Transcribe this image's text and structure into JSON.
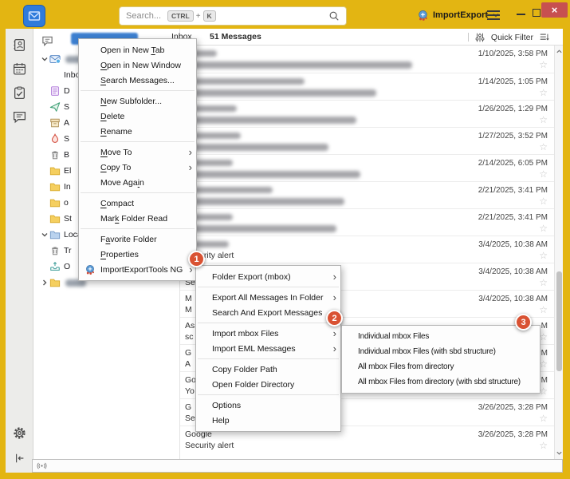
{
  "titlebar": {
    "search_placeholder": "Search...",
    "ctrl_key": "CTRL",
    "plus": "+",
    "k_key": "K",
    "addon_button_label": "ImportExport",
    "close_glyph": "×"
  },
  "header": {
    "folder_tab_label": "Inbox",
    "message_count": "51 Messages",
    "quick_filter_label": "Quick Filter"
  },
  "badges": {
    "one": "1",
    "two": "2",
    "three": "3"
  },
  "colors": {
    "titlebar_yellow": "#e3b512",
    "close_button_red": "#c75050",
    "selection_blue": "#1373d9",
    "badge_orange": "#d95233",
    "menu_highlight_grey": "#d2d2d2"
  },
  "icon_names": [
    "mail-space-icon",
    "search-icon",
    "hamburger-icon",
    "address-book-icon",
    "calendar-icon",
    "tasks-icon",
    "chat-icon",
    "gear-icon",
    "collapse-icon",
    "new-message-bubble-icon",
    "quick-filter-icon",
    "display-options-icon",
    "star-icon",
    "radio-tower-icon",
    "importexporttools-icon",
    "chevron-icons",
    "folder-icons"
  ],
  "folders": [
    {
      "icon": "account",
      "chevron": "chevron-down",
      "blur_w": 72,
      "bold": true,
      "indent": 0
    },
    {
      "icon": "inbox",
      "label": "Inbox",
      "selected": true,
      "indent": 1
    },
    {
      "icon": "drafts",
      "label": "D",
      "indent": 1
    },
    {
      "icon": "sent",
      "label": "S",
      "indent": 1
    },
    {
      "icon": "archive",
      "label": "A",
      "indent": 1
    },
    {
      "icon": "spam",
      "label": "S",
      "indent": 1
    },
    {
      "icon": "trash",
      "label": "B",
      "indent": 1
    },
    {
      "icon": "folder",
      "label": "El",
      "indent": 1
    },
    {
      "icon": "folder",
      "label": "In",
      "indent": 1
    },
    {
      "icon": "folder",
      "label": "o",
      "indent": 1
    },
    {
      "icon": "folder",
      "label": "St",
      "indent": 1
    },
    {
      "icon": "folder-blue",
      "label": "Local Folders",
      "chevron": "chevron-down",
      "bold": true,
      "indent": 0
    },
    {
      "icon": "trash",
      "label": "Tr",
      "indent": 1
    },
    {
      "icon": "outbox",
      "label": "O",
      "indent": 1
    },
    {
      "icon": "folder",
      "chevron": "chevron-right",
      "blur_w": 26,
      "dashed": true,
      "indent": 1
    }
  ],
  "menu1": {
    "items": [
      {
        "label": "Open in New Tab",
        "u": 12
      },
      {
        "label": "Open in New Window",
        "u": 0
      },
      {
        "label": "Search Messages...",
        "u": 0,
        "sep_after": true
      },
      {
        "label": "New Subfolder...",
        "u": 0
      },
      {
        "label": "Delete",
        "u": 0
      },
      {
        "label": "Rename",
        "u": 0,
        "sep_after": true
      },
      {
        "label": "Move To",
        "u": 0,
        "arrow": true
      },
      {
        "label": "Copy To",
        "u": 0,
        "arrow": true
      },
      {
        "label": "Move Again",
        "u": 8,
        "sep_after": true
      },
      {
        "label": "Compact",
        "u": 0
      },
      {
        "label": "Mark Folder Read",
        "u": 3,
        "sep_after": true
      },
      {
        "label": "Favorite Folder",
        "u": 1
      },
      {
        "label": "Properties",
        "u": 0
      },
      {
        "label": "ImportExportTools NG",
        "icon": "iet",
        "arrow": true,
        "highlight": true
      }
    ]
  },
  "menu2": {
    "items": [
      {
        "label": "Folder Export (mbox)",
        "arrow": true,
        "sep_after": true
      },
      {
        "label": "Export All Messages In Folder",
        "arrow": true
      },
      {
        "label": "Search And Export Messages",
        "sep_after": true
      },
      {
        "label": "Import mbox Files",
        "arrow": true,
        "highlight": true
      },
      {
        "label": "Import EML Messages",
        "arrow": true,
        "sep_after": true
      },
      {
        "label": "Copy Folder Path"
      },
      {
        "label": "Open Folder Directory",
        "sep_after": true
      },
      {
        "label": "Options"
      },
      {
        "label": "Help"
      }
    ]
  },
  "menu3": {
    "items": [
      {
        "label": "Individual mbox Files",
        "highlight": true
      },
      {
        "label": "Individual mbox Files (with sbd structure)"
      },
      {
        "label": "All mbox Files from directory"
      },
      {
        "label": "All mbox Files from directory (with sbd structure)"
      }
    ]
  },
  "messages": [
    {
      "sender_blur_w": 40,
      "subject_blur_w": 285,
      "unread": true,
      "date": "1/10/2025, 3:58 PM"
    },
    {
      "sender_blur_w": 150,
      "subject_blur_w": 240,
      "date": "1/14/2025, 1:05 PM"
    },
    {
      "sender_blur_w": 65,
      "subject_blur_w": 215,
      "date": "1/26/2025, 1:29 PM"
    },
    {
      "sender_blur_w": 70,
      "subject_blur_w": 180,
      "unread": true,
      "date": "1/27/2025, 3:52 PM"
    },
    {
      "sender_blur_w": 60,
      "subject_blur_w": 220,
      "unread": true,
      "date": "2/14/2025, 6:05 PM"
    },
    {
      "sender_blur_w": 110,
      "subject_blur_w": 200,
      "date": "2/21/2025, 3:41 PM"
    },
    {
      "sender_blur_w": 60,
      "subject_blur_w": 190,
      "date": "2/21/2025, 3:41 PM"
    },
    {
      "sender_blur_w": 55,
      "subject": "Security alert",
      "date": "3/4/2025, 10:38 AM"
    },
    {
      "sender_blur_w": 60,
      "subject": "Se",
      "date": "3/4/2025, 10:38 AM"
    },
    {
      "sender": "M",
      "subject": "M",
      "unread": true,
      "date": "3/4/2025, 10:38 AM"
    },
    {
      "sender": "As",
      "subject": "sc",
      "date": "M"
    },
    {
      "sender": "G",
      "subject": "A",
      "unread": true,
      "date": "PM"
    },
    {
      "sender": "Go",
      "subject": "Yo",
      "date": "PM"
    },
    {
      "sender": "G",
      "subject": "Se",
      "unread": true,
      "date": "3/26/2025, 3:28 PM"
    },
    {
      "sender": "Google",
      "subject": "Security alert",
      "unread": true,
      "date": "3/26/2025, 3:28 PM"
    }
  ]
}
